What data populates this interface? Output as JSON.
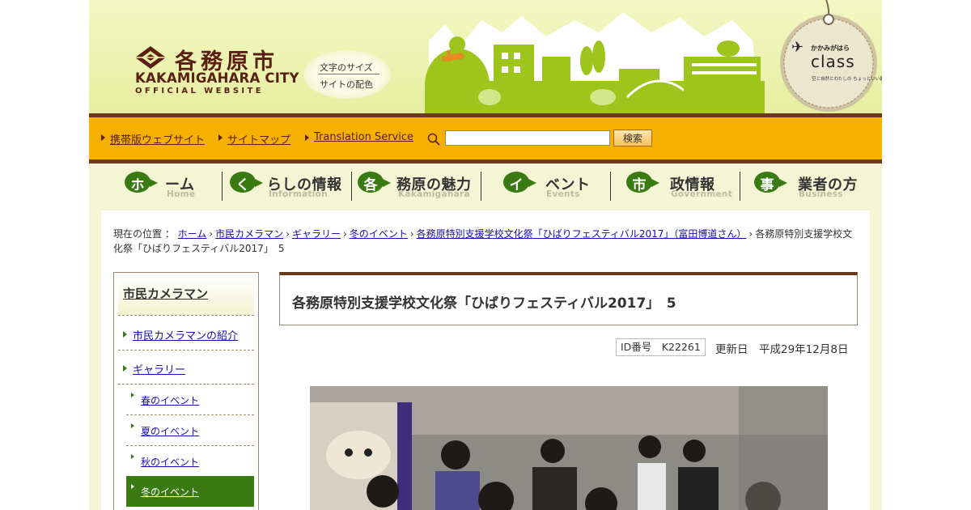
{
  "header": {
    "logo_jp": "各務原市",
    "logo_en_line1": "KAKAMIGAHARA CITY",
    "logo_en_line2": "OFFICIAL WEBSITE",
    "font_size_label": "文字のサイズ",
    "color_label": "サイトの配色",
    "tag_line1": "かかみがはら",
    "tag_line2": "class",
    "tag_line3": "空と自然とわたしの ちょっといい暮らし"
  },
  "utility": {
    "links": [
      "携帯版ウェブサイト",
      "サイトマップ",
      "Translation Service"
    ],
    "search_placeholder": "",
    "search_button": "検索"
  },
  "nav": [
    {
      "badge": "ホ",
      "label": "ーム",
      "en": "Home"
    },
    {
      "badge": "く",
      "label": "らしの情報",
      "en": "Information"
    },
    {
      "badge": "各",
      "label": "務原の魅力",
      "en": "Kakamigahara"
    },
    {
      "badge": "イ",
      "label": "ベント",
      "en": "Events"
    },
    {
      "badge": "市",
      "label": "政情報",
      "en": "Government"
    },
    {
      "badge": "事",
      "label": "業者の方",
      "en": "Business"
    }
  ],
  "breadcrumb": {
    "prefix": "現在の位置 ：",
    "links": [
      "ホーム",
      "市民カメラマン",
      "ギャラリー",
      "冬のイベント",
      "各務原特別支援学校文化祭「ひばりフェスティバル2017」（富田博道さん）"
    ],
    "current": "各務原特別支援学校文化祭「ひばりフェスティバル2017」　5"
  },
  "sidebar": {
    "title": "市民カメラマン",
    "level1": [
      "市民カメラマンの紹介",
      "ギャラリー"
    ],
    "level2": [
      "春のイベント",
      "夏のイベント",
      "秋のイベント",
      "冬のイベント"
    ]
  },
  "article": {
    "title": "各務原特別支援学校文化祭「ひばりフェスティバル2017」　5",
    "id_label": "ID番号　K22261",
    "updated": "更新日　平成29年12月8日"
  },
  "colors": {
    "brown": "#6b3a1d",
    "orange": "#f5b000",
    "green": "#3a7a12",
    "cream": "#f4f5d4",
    "link": "#1a0dab"
  }
}
